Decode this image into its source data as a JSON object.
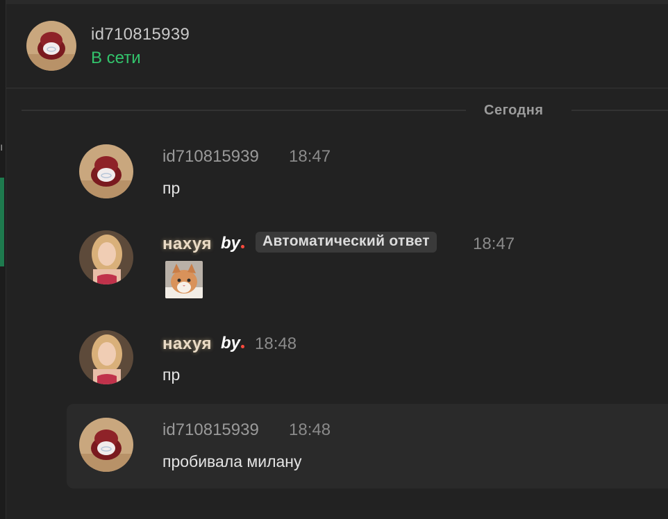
{
  "header": {
    "title": "id710815939",
    "status": "В сети"
  },
  "divider": {
    "label": "Сегодня"
  },
  "messages": [
    {
      "author": "id710815939",
      "time": "18:47",
      "text": "пр",
      "avatar": "ring-box-avatar"
    },
    {
      "author": "нахуя",
      "badge": "by",
      "auto_label": "Автоматический ответ",
      "time": "18:47",
      "attachment": "cat-sticker",
      "avatar": "girl-avatar"
    },
    {
      "author": "нахуя",
      "badge": "by",
      "time": "18:48",
      "text": "пр",
      "avatar": "girl-avatar"
    },
    {
      "author": "id710815939",
      "time": "18:48",
      "text": "пробивала милану",
      "avatar": "ring-box-avatar",
      "highlighted": true
    }
  ],
  "colors": {
    "background": "#222222",
    "online": "#33c46c",
    "accent_strip": "#1e7a4e",
    "badge_dot": "#ff4a3d"
  }
}
